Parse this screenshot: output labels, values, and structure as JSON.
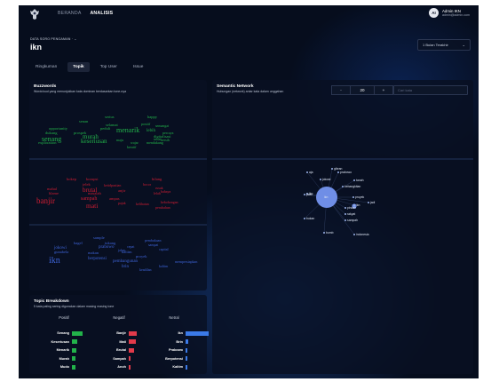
{
  "nav": {
    "home": "BERANDA",
    "analysis": "ANALISIS"
  },
  "user": {
    "initials": "AI",
    "name": "Admin IKN",
    "email": "admin@admin.com"
  },
  "breadcrumb": "DATA SORO PENGAMAN · ⌄",
  "page_title": "ikn",
  "period": {
    "selected": "1 Bulan Terakhir",
    "chevron": "⌄"
  },
  "tabs": [
    {
      "label": "Ringkuman",
      "active": false
    },
    {
      "label": "Topik",
      "active": true
    },
    {
      "label": "Top User",
      "active": false
    },
    {
      "label": "Issue",
      "active": false
    }
  ],
  "buzzwords": {
    "title": "Buzzwords",
    "subtitle": "Wordcloud yang menunjukkan kata dominan berdasarkan tone-nya",
    "colors": {
      "positive": "#22b34a",
      "negative": "#d21d33",
      "neutral": "#3d63d6"
    },
    "positive": [
      {
        "t": "serius",
        "s": 4.5
      },
      {
        "t": "happy",
        "s": 4.5
      },
      {
        "t": "senan",
        "s": 4.5
      },
      {
        "t": "selamat",
        "s": 4.5
      },
      {
        "t": "positif",
        "s": 4
      },
      {
        "t": "semangat",
        "s": 4
      },
      {
        "t": "opportunity",
        "s": 4.5
      },
      {
        "t": "peduli",
        "s": 4.5
      },
      {
        "t": "menarik",
        "s": 8
      },
      {
        "t": "lebih",
        "s": 5
      },
      {
        "t": "percaya",
        "s": 4
      },
      {
        "t": "dukung",
        "s": 4.5
      },
      {
        "t": "prospek",
        "s": 4.5
      },
      {
        "t": "murah",
        "s": 7
      },
      {
        "t": "digitalisasi",
        "s": 4.5
      },
      {
        "t": "senang",
        "s": 8
      },
      {
        "t": "keseriusan",
        "s": 7
      },
      {
        "t": "maju",
        "s": 4
      },
      {
        "t": "exploration",
        "s": 4.5
      },
      {
        "t": "wajar",
        "s": 4
      },
      {
        "t": "mendukung",
        "s": 4
      },
      {
        "t": "kreatif",
        "s": 4
      },
      {
        "t": "sehat",
        "s": 4
      },
      {
        "t": "bersih",
        "s": 4
      }
    ],
    "negative": [
      {
        "t": "bokep",
        "s": 4.5
      },
      {
        "t": "korupsi",
        "s": 4.5
      },
      {
        "t": "hilang",
        "s": 4.5
      },
      {
        "t": "jelek",
        "s": 4.5
      },
      {
        "t": "ketidpastian",
        "s": 4
      },
      {
        "t": "bocor",
        "s": 4
      },
      {
        "t": "mahal",
        "s": 4.5
      },
      {
        "t": "brutal",
        "s": 7
      },
      {
        "t": "rusak",
        "s": 4
      },
      {
        "t": "bahaya",
        "s": 4
      },
      {
        "t": "blame",
        "s": 4.5
      },
      {
        "t": "masalah",
        "s": 4.5
      },
      {
        "t": "anjir",
        "s": 4.5
      },
      {
        "t": "lelah",
        "s": 4
      },
      {
        "t": "banjir",
        "s": 9
      },
      {
        "t": "sampah",
        "s": 6
      },
      {
        "t": "ampas",
        "s": 4.5
      },
      {
        "t": "mati",
        "s": 7.5
      },
      {
        "t": "pajak",
        "s": 4
      },
      {
        "t": "kelihatan",
        "s": 4
      },
      {
        "t": "kebohongan",
        "s": 4
      },
      {
        "t": "perubahan",
        "s": 4
      }
    ],
    "neutral": [
      {
        "t": "sample",
        "s": 4.5
      },
      {
        "t": "pembukaan",
        "s": 4
      },
      {
        "t": "bagel",
        "s": 4.5
      },
      {
        "t": "tukang",
        "s": 4.5
      },
      {
        "t": "sampai",
        "s": 4
      },
      {
        "t": "jokowi",
        "s": 5
      },
      {
        "t": "prabowo",
        "s": 5
      },
      {
        "t": "cepat",
        "s": 4
      },
      {
        "t": "capital",
        "s": 4
      },
      {
        "t": "jalan",
        "s": 4
      },
      {
        "t": "gunabela",
        "s": 4.5
      },
      {
        "t": "makan",
        "s": 4.5
      },
      {
        "t": "kaltim",
        "s": 4.5
      },
      {
        "t": "ikn",
        "s": 10
      },
      {
        "t": "berpotensi",
        "s": 5
      },
      {
        "t": "pembangunan",
        "s": 5
      },
      {
        "t": "proyek",
        "s": 4.5
      },
      {
        "t": "brin",
        "s": 5
      },
      {
        "t": "kaltim",
        "s": 4
      },
      {
        "t": "mempersiapkan",
        "s": 4
      },
      {
        "t": "keadilan",
        "s": 4
      }
    ]
  },
  "semantic_network": {
    "title": "Semantic Network",
    "subtitle": "Hubungan (network) antar kata dalam unggahan",
    "minus": "-",
    "plus": "+",
    "value": "20",
    "search_placeholder": "Cari kata",
    "center_label": "ikn",
    "nodes": [
      "gibran",
      "prabowo",
      "aja",
      "jokowi",
      "tanah",
      "kebangkitan",
      "ikn",
      "jalan",
      "proyek",
      "jadi",
      "pindah",
      "ikn",
      "bukan",
      "rakyat",
      "sampah",
      "bumb",
      "indonesia"
    ]
  },
  "topic_breakdown": {
    "title": "Topic Breakdown",
    "subtitle": "5 kata paling sering digunakan dalam masing masing tone",
    "columns": [
      "Positif",
      "Negatif",
      "Netral"
    ],
    "colors": {
      "positive": "#22b34a",
      "negative": "#e23a4a",
      "neutral": "#3b7ae8"
    },
    "positive": [
      {
        "label": "Senang",
        "value": 0.48
      },
      {
        "label": "Keseriusan",
        "value": 0.23
      },
      {
        "label": "Menarik",
        "value": 0.18
      },
      {
        "label": "Murah",
        "value": 0.15
      },
      {
        "label": "Mudo",
        "value": 0.14
      }
    ],
    "negative": [
      {
        "label": "Banjir",
        "value": 0.34
      },
      {
        "label": "Mati",
        "value": 0.3
      },
      {
        "label": "Brutal",
        "value": 0.24
      },
      {
        "label": "Sampah",
        "value": 0.09
      },
      {
        "label": "Anoh",
        "value": 0.05
      }
    ],
    "neutral": [
      {
        "label": "Ikn",
        "value": 1.0
      },
      {
        "label": "Brin",
        "value": 0.11
      },
      {
        "label": "Prabowo",
        "value": 0.07
      },
      {
        "label": "Berpotensi",
        "value": 0.05
      },
      {
        "label": "Kaltim",
        "value": 0.04
      }
    ]
  }
}
